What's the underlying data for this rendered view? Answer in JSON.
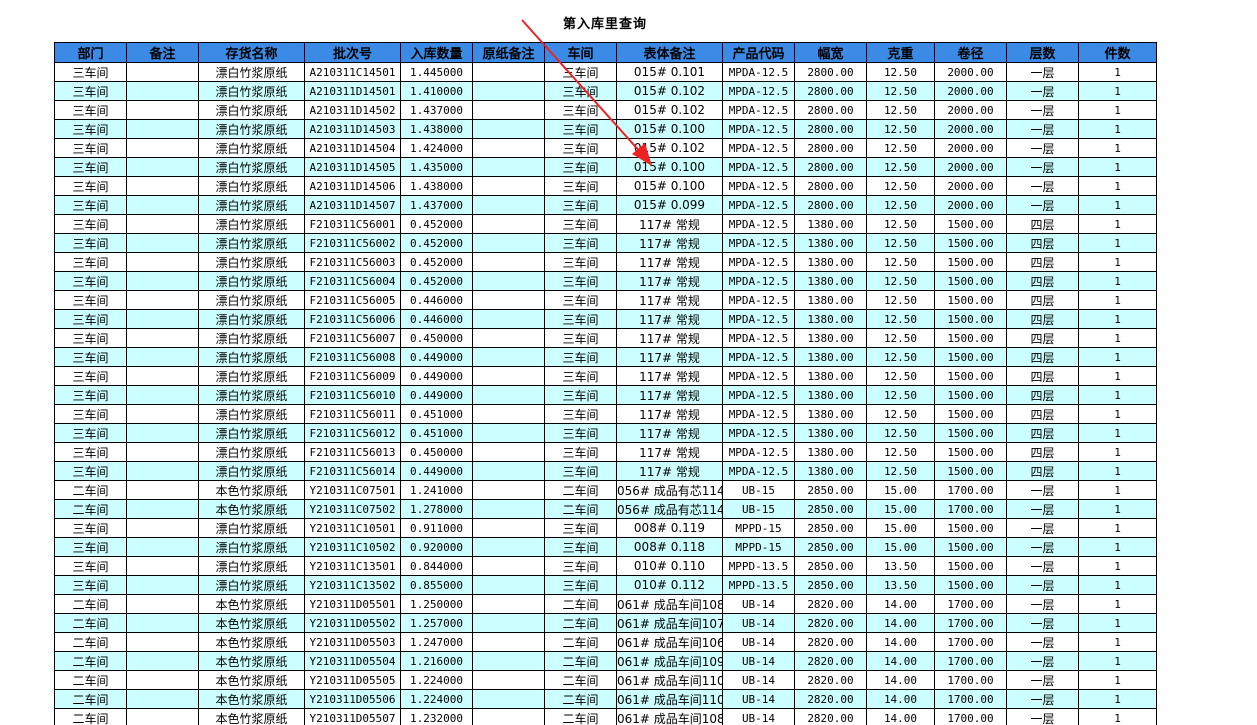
{
  "title": "第入库里查询",
  "columns": [
    "部门",
    "备注",
    "存货名称",
    "批次号",
    "入库数量",
    "原纸备注",
    "车间",
    "表体备注",
    "产品代码",
    "幅宽",
    "克重",
    "卷径",
    "层数",
    "件数"
  ],
  "rows": [
    [
      "三车间",
      "",
      "漂白竹浆原纸",
      "A210311C14501",
      "1.445000",
      "",
      "三车间",
      "015# 0.101",
      "MPDA-12.5",
      "2800.00",
      "12.50",
      "2000.00",
      "一层",
      "1"
    ],
    [
      "三车间",
      "",
      "漂白竹浆原纸",
      "A210311D14501",
      "1.410000",
      "",
      "三车间",
      "015# 0.102",
      "MPDA-12.5",
      "2800.00",
      "12.50",
      "2000.00",
      "一层",
      "1"
    ],
    [
      "三车间",
      "",
      "漂白竹浆原纸",
      "A210311D14502",
      "1.437000",
      "",
      "三车间",
      "015# 0.102",
      "MPDA-12.5",
      "2800.00",
      "12.50",
      "2000.00",
      "一层",
      "1"
    ],
    [
      "三车间",
      "",
      "漂白竹浆原纸",
      "A210311D14503",
      "1.438000",
      "",
      "三车间",
      "015# 0.100",
      "MPDA-12.5",
      "2800.00",
      "12.50",
      "2000.00",
      "一层",
      "1"
    ],
    [
      "三车间",
      "",
      "漂白竹浆原纸",
      "A210311D14504",
      "1.424000",
      "",
      "三车间",
      "015# 0.102",
      "MPDA-12.5",
      "2800.00",
      "12.50",
      "2000.00",
      "一层",
      "1"
    ],
    [
      "三车间",
      "",
      "漂白竹浆原纸",
      "A210311D14505",
      "1.435000",
      "",
      "三车间",
      "015# 0.100",
      "MPDA-12.5",
      "2800.00",
      "12.50",
      "2000.00",
      "一层",
      "1"
    ],
    [
      "三车间",
      "",
      "漂白竹浆原纸",
      "A210311D14506",
      "1.438000",
      "",
      "三车间",
      "015# 0.100",
      "MPDA-12.5",
      "2800.00",
      "12.50",
      "2000.00",
      "一层",
      "1"
    ],
    [
      "三车间",
      "",
      "漂白竹浆原纸",
      "A210311D14507",
      "1.437000",
      "",
      "三车间",
      "015# 0.099",
      "MPDA-12.5",
      "2800.00",
      "12.50",
      "2000.00",
      "一层",
      "1"
    ],
    [
      "三车间",
      "",
      "漂白竹浆原纸",
      "F210311C56001",
      "0.452000",
      "",
      "三车间",
      "117# 常规",
      "MPDA-12.5",
      "1380.00",
      "12.50",
      "1500.00",
      "四层",
      "1"
    ],
    [
      "三车间",
      "",
      "漂白竹浆原纸",
      "F210311C56002",
      "0.452000",
      "",
      "三车间",
      "117# 常规",
      "MPDA-12.5",
      "1380.00",
      "12.50",
      "1500.00",
      "四层",
      "1"
    ],
    [
      "三车间",
      "",
      "漂白竹浆原纸",
      "F210311C56003",
      "0.452000",
      "",
      "三车间",
      "117# 常规",
      "MPDA-12.5",
      "1380.00",
      "12.50",
      "1500.00",
      "四层",
      "1"
    ],
    [
      "三车间",
      "",
      "漂白竹浆原纸",
      "F210311C56004",
      "0.452000",
      "",
      "三车间",
      "117# 常规",
      "MPDA-12.5",
      "1380.00",
      "12.50",
      "1500.00",
      "四层",
      "1"
    ],
    [
      "三车间",
      "",
      "漂白竹浆原纸",
      "F210311C56005",
      "0.446000",
      "",
      "三车间",
      "117# 常规",
      "MPDA-12.5",
      "1380.00",
      "12.50",
      "1500.00",
      "四层",
      "1"
    ],
    [
      "三车间",
      "",
      "漂白竹浆原纸",
      "F210311C56006",
      "0.446000",
      "",
      "三车间",
      "117# 常规",
      "MPDA-12.5",
      "1380.00",
      "12.50",
      "1500.00",
      "四层",
      "1"
    ],
    [
      "三车间",
      "",
      "漂白竹浆原纸",
      "F210311C56007",
      "0.450000",
      "",
      "三车间",
      "117# 常规",
      "MPDA-12.5",
      "1380.00",
      "12.50",
      "1500.00",
      "四层",
      "1"
    ],
    [
      "三车间",
      "",
      "漂白竹浆原纸",
      "F210311C56008",
      "0.449000",
      "",
      "三车间",
      "117# 常规",
      "MPDA-12.5",
      "1380.00",
      "12.50",
      "1500.00",
      "四层",
      "1"
    ],
    [
      "三车间",
      "",
      "漂白竹浆原纸",
      "F210311C56009",
      "0.449000",
      "",
      "三车间",
      "117# 常规",
      "MPDA-12.5",
      "1380.00",
      "12.50",
      "1500.00",
      "四层",
      "1"
    ],
    [
      "三车间",
      "",
      "漂白竹浆原纸",
      "F210311C56010",
      "0.449000",
      "",
      "三车间",
      "117# 常规",
      "MPDA-12.5",
      "1380.00",
      "12.50",
      "1500.00",
      "四层",
      "1"
    ],
    [
      "三车间",
      "",
      "漂白竹浆原纸",
      "F210311C56011",
      "0.451000",
      "",
      "三车间",
      "117# 常规",
      "MPDA-12.5",
      "1380.00",
      "12.50",
      "1500.00",
      "四层",
      "1"
    ],
    [
      "三车间",
      "",
      "漂白竹浆原纸",
      "F210311C56012",
      "0.451000",
      "",
      "三车间",
      "117# 常规",
      "MPDA-12.5",
      "1380.00",
      "12.50",
      "1500.00",
      "四层",
      "1"
    ],
    [
      "三车间",
      "",
      "漂白竹浆原纸",
      "F210311C56013",
      "0.450000",
      "",
      "三车间",
      "117# 常规",
      "MPDA-12.5",
      "1380.00",
      "12.50",
      "1500.00",
      "四层",
      "1"
    ],
    [
      "三车间",
      "",
      "漂白竹浆原纸",
      "F210311C56014",
      "0.449000",
      "",
      "三车间",
      "117# 常规",
      "MPDA-12.5",
      "1380.00",
      "12.50",
      "1500.00",
      "四层",
      "1"
    ],
    [
      "二车间",
      "",
      "本色竹浆原纸",
      "Y210311C07501",
      "1.241000",
      "",
      "二车间",
      "056# 成品有芯114",
      "UB-15",
      "2850.00",
      "15.00",
      "1700.00",
      "一层",
      "1"
    ],
    [
      "二车间",
      "",
      "本色竹浆原纸",
      "Y210311C07502",
      "1.278000",
      "",
      "二车间",
      "056# 成品有芯114",
      "UB-15",
      "2850.00",
      "15.00",
      "1700.00",
      "一层",
      "1"
    ],
    [
      "三车间",
      "",
      "漂白竹浆原纸",
      "Y210311C10501",
      "0.911000",
      "",
      "三车间",
      "008# 0.119",
      "MPPD-15",
      "2850.00",
      "15.00",
      "1500.00",
      "一层",
      "1"
    ],
    [
      "三车间",
      "",
      "漂白竹浆原纸",
      "Y210311C10502",
      "0.920000",
      "",
      "三车间",
      "008# 0.118",
      "MPPD-15",
      "2850.00",
      "15.00",
      "1500.00",
      "一层",
      "1"
    ],
    [
      "三车间",
      "",
      "漂白竹浆原纸",
      "Y210311C13501",
      "0.844000",
      "",
      "三车间",
      "010# 0.110",
      "MPPD-13.5",
      "2850.00",
      "13.50",
      "1500.00",
      "一层",
      "1"
    ],
    [
      "三车间",
      "",
      "漂白竹浆原纸",
      "Y210311C13502",
      "0.855000",
      "",
      "三车间",
      "010# 0.112",
      "MPPD-13.5",
      "2850.00",
      "13.50",
      "1500.00",
      "一层",
      "1"
    ],
    [
      "二车间",
      "",
      "本色竹浆原纸",
      "Y210311D05501",
      "1.250000",
      "",
      "二车间",
      "061# 成品车间108",
      "UB-14",
      "2820.00",
      "14.00",
      "1700.00",
      "一层",
      "1"
    ],
    [
      "二车间",
      "",
      "本色竹浆原纸",
      "Y210311D05502",
      "1.257000",
      "",
      "二车间",
      "061# 成品车间107",
      "UB-14",
      "2820.00",
      "14.00",
      "1700.00",
      "一层",
      "1"
    ],
    [
      "二车间",
      "",
      "本色竹浆原纸",
      "Y210311D05503",
      "1.247000",
      "",
      "二车间",
      "061# 成品车间106",
      "UB-14",
      "2820.00",
      "14.00",
      "1700.00",
      "一层",
      "1"
    ],
    [
      "二车间",
      "",
      "本色竹浆原纸",
      "Y210311D05504",
      "1.216000",
      "",
      "二车间",
      "061# 成品车间109",
      "UB-14",
      "2820.00",
      "14.00",
      "1700.00",
      "一层",
      "1"
    ],
    [
      "二车间",
      "",
      "本色竹浆原纸",
      "Y210311D05505",
      "1.224000",
      "",
      "二车间",
      "061# 成品车间110",
      "UB-14",
      "2820.00",
      "14.00",
      "1700.00",
      "一层",
      "1"
    ],
    [
      "二车间",
      "",
      "本色竹浆原纸",
      "Y210311D05506",
      "1.224000",
      "",
      "二车间",
      "061# 成品车间110",
      "UB-14",
      "2820.00",
      "14.00",
      "1700.00",
      "一层",
      "1"
    ],
    [
      "二车间",
      "",
      "本色竹浆原纸",
      "Y210311D05507",
      "1.232000",
      "",
      "二车间",
      "061# 成品车间108",
      "UB-14",
      "2820.00",
      "14.00",
      "1700.00",
      "一层",
      "1"
    ]
  ],
  "colors": {
    "header_bg": "#3a8ae6",
    "row_alt_bg": "#ccffff",
    "row_bg": "#ffffff",
    "arrow": "#ee2222"
  },
  "annotation_icon": "red-arrow-icon"
}
